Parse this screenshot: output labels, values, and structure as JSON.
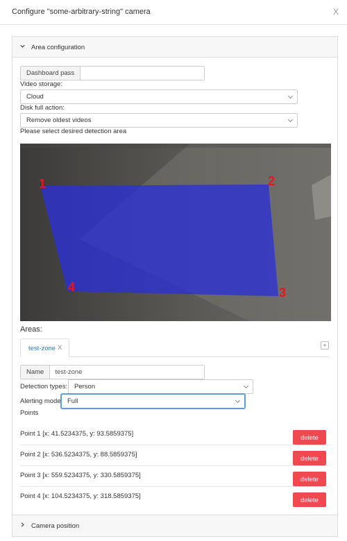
{
  "modal": {
    "title": "Configure \"some-arbitrary-string\" camera",
    "close": "X"
  },
  "area_panel": {
    "title": "Area configuration"
  },
  "dashboard_pass": {
    "label": "Dashboard pass",
    "value": ""
  },
  "video_storage": {
    "label": "Video storage:",
    "value": "Cloud"
  },
  "disk_full": {
    "label": "Disk full action:",
    "value": "Remove oldest videos"
  },
  "detection_prompt": "Please select desired detection area",
  "zone_points": [
    {
      "label": "1"
    },
    {
      "label": "2"
    },
    {
      "label": "3"
    },
    {
      "label": "4"
    }
  ],
  "colors": {
    "zone_fill": "#2a2fd6",
    "point_label": "#e8161c",
    "delete_button": "#f0484f",
    "tab_link": "#337ab7"
  },
  "areas": {
    "heading": "Areas:",
    "tab_label": "test-zone",
    "tab_close": "X",
    "add_label": "+",
    "name_label": "Name",
    "name_value": "test-zone",
    "detection_label": "Detection types:",
    "detection_value": "Person",
    "alerting_label": "Alerting mode",
    "alerting_value": "Full",
    "points_heading": "Points",
    "points": [
      {
        "text": "Point 1 [x: 41.5234375, y: 93.5859375]",
        "delete": "delete"
      },
      {
        "text": "Point 2 [x: 536.5234375, y: 88.5859375]",
        "delete": "delete"
      },
      {
        "text": "Point 3 [x: 559.5234375, y: 330.5859375]",
        "delete": "delete"
      },
      {
        "text": "Point 4 [x: 104.5234375, y: 318.5859375]",
        "delete": "delete"
      }
    ]
  },
  "camera_panel": {
    "title": "Camera position"
  }
}
